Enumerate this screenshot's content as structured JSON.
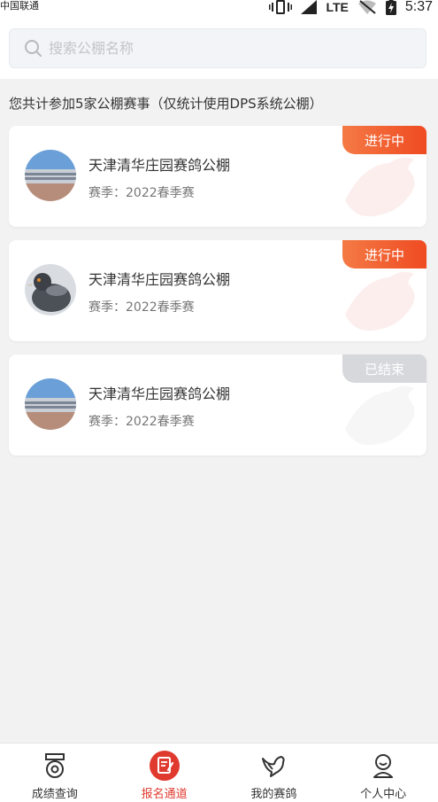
{
  "status_bar": {
    "carrier": "中国联通",
    "network": "LTE",
    "time": "5:37"
  },
  "search": {
    "placeholder": "搜索公棚名称",
    "value": ""
  },
  "summary": "您共计参加5家公棚赛事（仅统计使用DPS系统公棚）",
  "cards": [
    {
      "title": "天津清华庄园赛鸽公棚",
      "season": "赛季：2022春季赛",
      "status": "进行中",
      "status_type": "active",
      "avatar": "building"
    },
    {
      "title": "天津清华庄园赛鸽公棚",
      "season": "赛季：2022春季赛",
      "status": "进行中",
      "status_type": "active",
      "avatar": "pigeon"
    },
    {
      "title": "天津清华庄园赛鸽公棚",
      "season": "赛季：2022春季赛",
      "status": "已结束",
      "status_type": "ended",
      "avatar": "building"
    }
  ],
  "tabbar": {
    "items": [
      {
        "label": "成绩查询",
        "icon": "medal-icon",
        "active": false
      },
      {
        "label": "报名通道",
        "icon": "signup-icon",
        "active": true
      },
      {
        "label": "我的赛鸽",
        "icon": "pigeon-icon",
        "active": false
      },
      {
        "label": "个人中心",
        "icon": "user-icon",
        "active": false
      }
    ]
  },
  "colors": {
    "accent": "#e03a2f",
    "badge_active": "#ef4b22",
    "badge_ended": "#d7d8dc"
  }
}
